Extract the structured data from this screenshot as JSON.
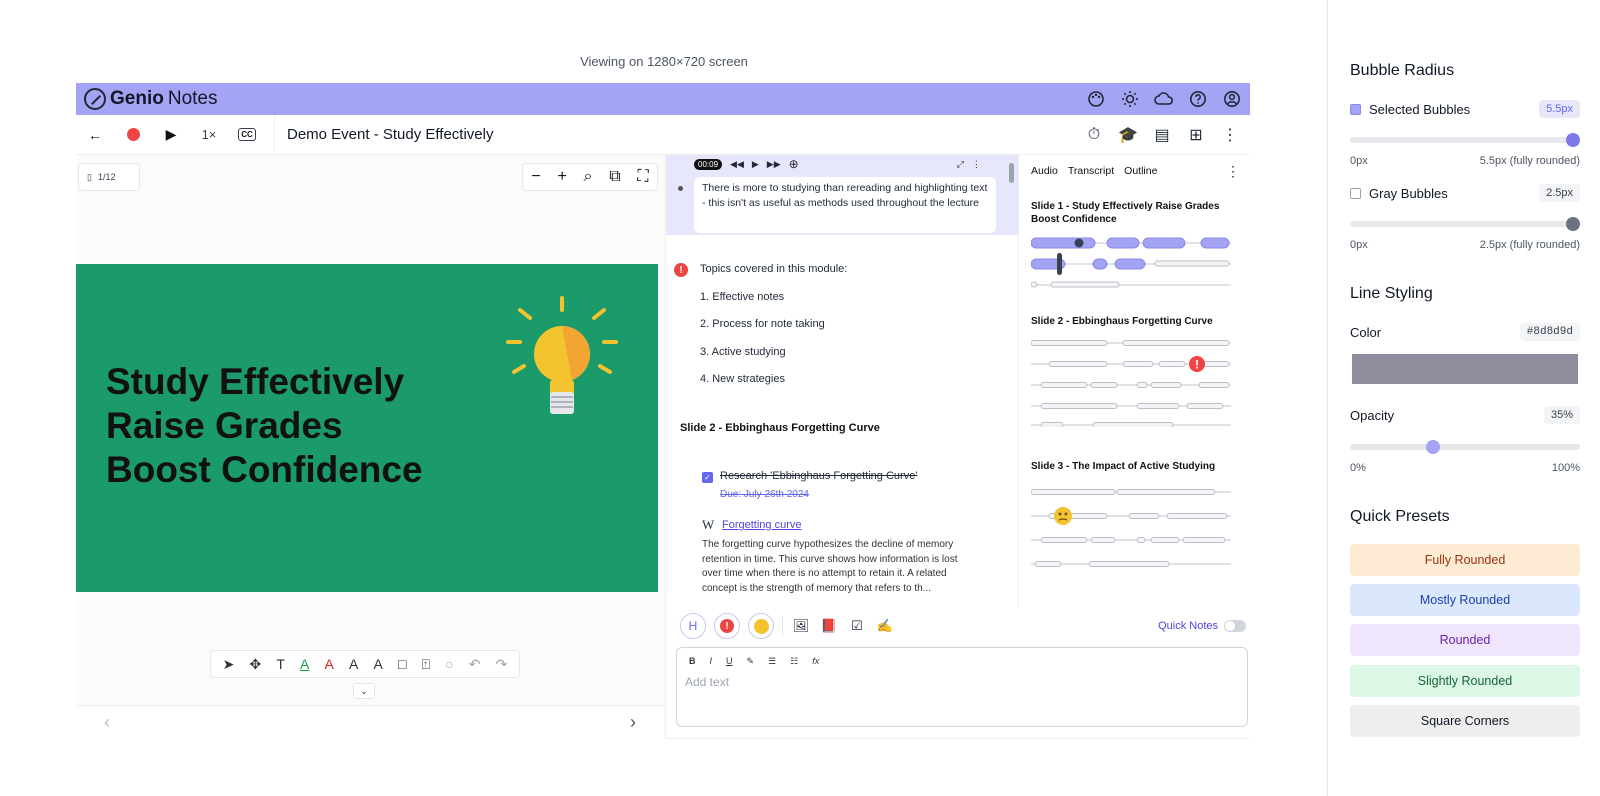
{
  "viewing_text": "Viewing on 1280×720 screen",
  "brand": {
    "name_a": "Genio",
    "name_b": "Notes",
    "bar_color": "#a5a3f3"
  },
  "toolbar": {
    "speed": "1×",
    "cc": "CC",
    "title": "Demo Event - Study Effectively"
  },
  "slide_pane": {
    "page": "1/12",
    "lines": [
      "Study Effectively",
      "Raise Grades",
      "Boost Confidence"
    ],
    "bg_color": "#1b9a6a"
  },
  "notes": {
    "time": "00:09",
    "active_note": "There is more to studying than rereading and highlighting text - this isn't as useful as methods used throughout the lecture",
    "topics_header": "Topics covered in this module:",
    "topics": [
      "1. Effective notes",
      "2. Process for note taking",
      "3. Active studying",
      "4. New strategies"
    ],
    "slide2_title": "Slide 2 - Ebbinghaus Forgetting Curve",
    "task": "Research 'Ebbinghaus Forgetting Curve'",
    "task_due": "Due: July 26th 2024",
    "wiki_label": "W",
    "wiki_link": "Forgetting curve",
    "wiki_text": "The forgetting curve hypothesizes the decline of memory retention in time. This curve shows how information is lost over time when there is no attempt to retain it. A related concept is the strength of memory that refers to th..."
  },
  "outline": {
    "tabs": [
      "Audio",
      "Transcript",
      "Outline"
    ],
    "slides": [
      "Slide 1 - Study Effectively Raise Grades Boost Confidence",
      "Slide 2 - Ebbinghaus Forgetting Curve",
      "Slide 3 - The Impact of Active Studying"
    ]
  },
  "composer": {
    "h_label": "H",
    "quick_notes": "Quick Notes",
    "format": [
      "B",
      "I",
      "U",
      "✎",
      "☰",
      "☷",
      "fx"
    ],
    "placeholder": "Add text"
  },
  "panel": {
    "bubble_radius_title": "Bubble Radius",
    "selected_label": "Selected Bubbles",
    "selected_value": "5.5px",
    "selected_fraction": 1.0,
    "selected_min": "0px",
    "selected_max": "5.5px (fully rounded)",
    "gray_label": "Gray Bubbles",
    "gray_value": "2.5px",
    "gray_fraction": 1.0,
    "gray_min": "0px",
    "gray_max": "2.5px (fully rounded)",
    "line_styling_title": "Line Styling",
    "color_label": "Color",
    "color_value": "#8d8d9d",
    "opacity_label": "Opacity",
    "opacity_value": "35%",
    "opacity_fraction": 0.35,
    "opacity_min": "0%",
    "opacity_max": "100%",
    "presets_title": "Quick Presets",
    "presets": [
      {
        "label": "Fully Rounded",
        "bg": "#fdebd3",
        "fg": "#9a3412"
      },
      {
        "label": "Mostly Rounded",
        "bg": "#dbe7fd",
        "fg": "#1e40af"
      },
      {
        "label": "Rounded",
        "bg": "#efe6fd",
        "fg": "#6b21a8"
      },
      {
        "label": "Slightly Rounded",
        "bg": "#dcf7e6",
        "fg": "#166534"
      },
      {
        "label": "Square Corners",
        "bg": "#eeeeef",
        "fg": "#111827"
      }
    ]
  }
}
